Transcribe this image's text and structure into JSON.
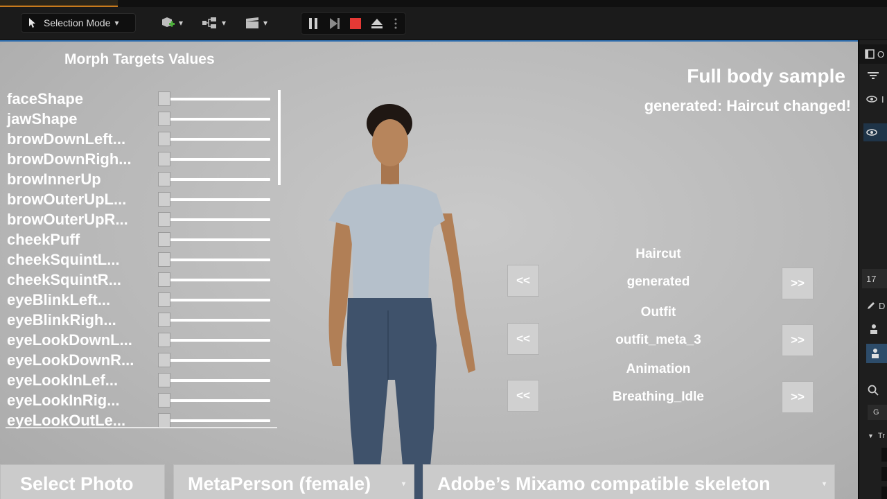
{
  "toolbar": {
    "mode_label": "Selection Mode"
  },
  "viewport": {
    "morph_title": "Morph Targets Values",
    "sample_title": "Full body sample",
    "sample_subtitle": "generated: Haircut changed!",
    "morphs": [
      {
        "label": "faceShape",
        "value": 0
      },
      {
        "label": "jawShape",
        "value": 0
      },
      {
        "label": "browDownLeft...",
        "value": 0
      },
      {
        "label": "browDownRigh...",
        "value": 0
      },
      {
        "label": "browInnerUp",
        "value": 0
      },
      {
        "label": "browOuterUpL...",
        "value": 0
      },
      {
        "label": "browOuterUpR...",
        "value": 0
      },
      {
        "label": "cheekPuff",
        "value": 0
      },
      {
        "label": "cheekSquintL...",
        "value": 0
      },
      {
        "label": "cheekSquintR...",
        "value": 0
      },
      {
        "label": "eyeBlinkLeft...",
        "value": 0
      },
      {
        "label": "eyeBlinkRigh...",
        "value": 0
      },
      {
        "label": "eyeLookDownL...",
        "value": 0
      },
      {
        "label": "eyeLookDownR...",
        "value": 0
      },
      {
        "label": "eyeLookInLef...",
        "value": 0
      },
      {
        "label": "eyeLookInRig...",
        "value": 0
      },
      {
        "label": "eyeLookOutLe...",
        "value": 0
      }
    ],
    "selectors": [
      {
        "label": "Haircut",
        "value": "generated",
        "prev": "<<",
        "next": ">>"
      },
      {
        "label": "Outfit",
        "value": "outfit_meta_3",
        "prev": "<<",
        "next": ">>"
      },
      {
        "label": "Animation",
        "value": "Breathing_Idle",
        "prev": "<<",
        "next": ">>"
      }
    ],
    "bottom": {
      "select_photo": "Select Photo",
      "person_type": "MetaPerson (female)",
      "skeleton": "Adobe’s Mixamo compatible skeleton"
    }
  },
  "right_panel": {
    "top_text": "O",
    "row1_text": "I",
    "number": "17",
    "d_text": "D",
    "g_text": "G",
    "tr_text": "Tr"
  }
}
